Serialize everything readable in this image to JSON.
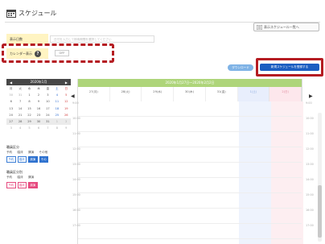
{
  "header": {
    "title": "スケジュール"
  },
  "view_button": {
    "label": "表示スケジュール一覧へ"
  },
  "filters": {
    "display_date_label": "表示日数",
    "date_placeholder": "日付を入力して検索期間を選択してください",
    "calendar_label": "カレンダー表示",
    "calendar_toggle": "OFF"
  },
  "actions": {
    "download": "ダウンロード",
    "new_schedule": "新規スケジュールを登録する"
  },
  "mini_calendar": {
    "month": "2020年1月",
    "prev": "◀",
    "next": "▶",
    "weekdays": [
      "月",
      "火",
      "水",
      "木",
      "金",
      "土",
      "日"
    ],
    "days": [
      "30",
      "31",
      "1",
      "2",
      "3",
      "4",
      "5",
      "6",
      "7",
      "8",
      "9",
      "10",
      "11",
      "12",
      "13",
      "14",
      "15",
      "16",
      "17",
      "18",
      "19",
      "20",
      "21",
      "22",
      "23",
      "24",
      "25",
      "26",
      "27",
      "28",
      "29",
      "30",
      "31",
      "1",
      "2",
      "3",
      "4",
      "5",
      "6",
      "7",
      "8",
      "9"
    ]
  },
  "legend_group1": {
    "title": "職員区分",
    "labels": [
      "予約",
      "臨床",
      "講演",
      "その他"
    ],
    "chips": [
      "予約",
      "臨床",
      "講演",
      "その他"
    ]
  },
  "legend_group2": {
    "title": "職員区分別",
    "labels": [
      "予約",
      "臨床",
      "講演"
    ],
    "chips": [
      "予約",
      "臨床",
      "講演"
    ]
  },
  "calendar": {
    "range": "2020年1月27日〜2020年2月2日",
    "days": [
      "27(月)",
      "28(火)",
      "29(水)",
      "30(木)",
      "31(金)",
      "1(土)",
      "2(日)"
    ],
    "times": [
      "9:00",
      "10:00",
      "11:00",
      "12:00",
      "13:00",
      "14:00",
      "15:00",
      "16:00",
      "17:00"
    ],
    "nav_prev": "◀",
    "nav_next": "▶"
  },
  "colors": {
    "accent": "#1c5ec1",
    "highlight": "#b51c22",
    "range_bar": "#aed57a"
  },
  "icons": {
    "header": "calendar-icon",
    "view": "list-icon"
  }
}
